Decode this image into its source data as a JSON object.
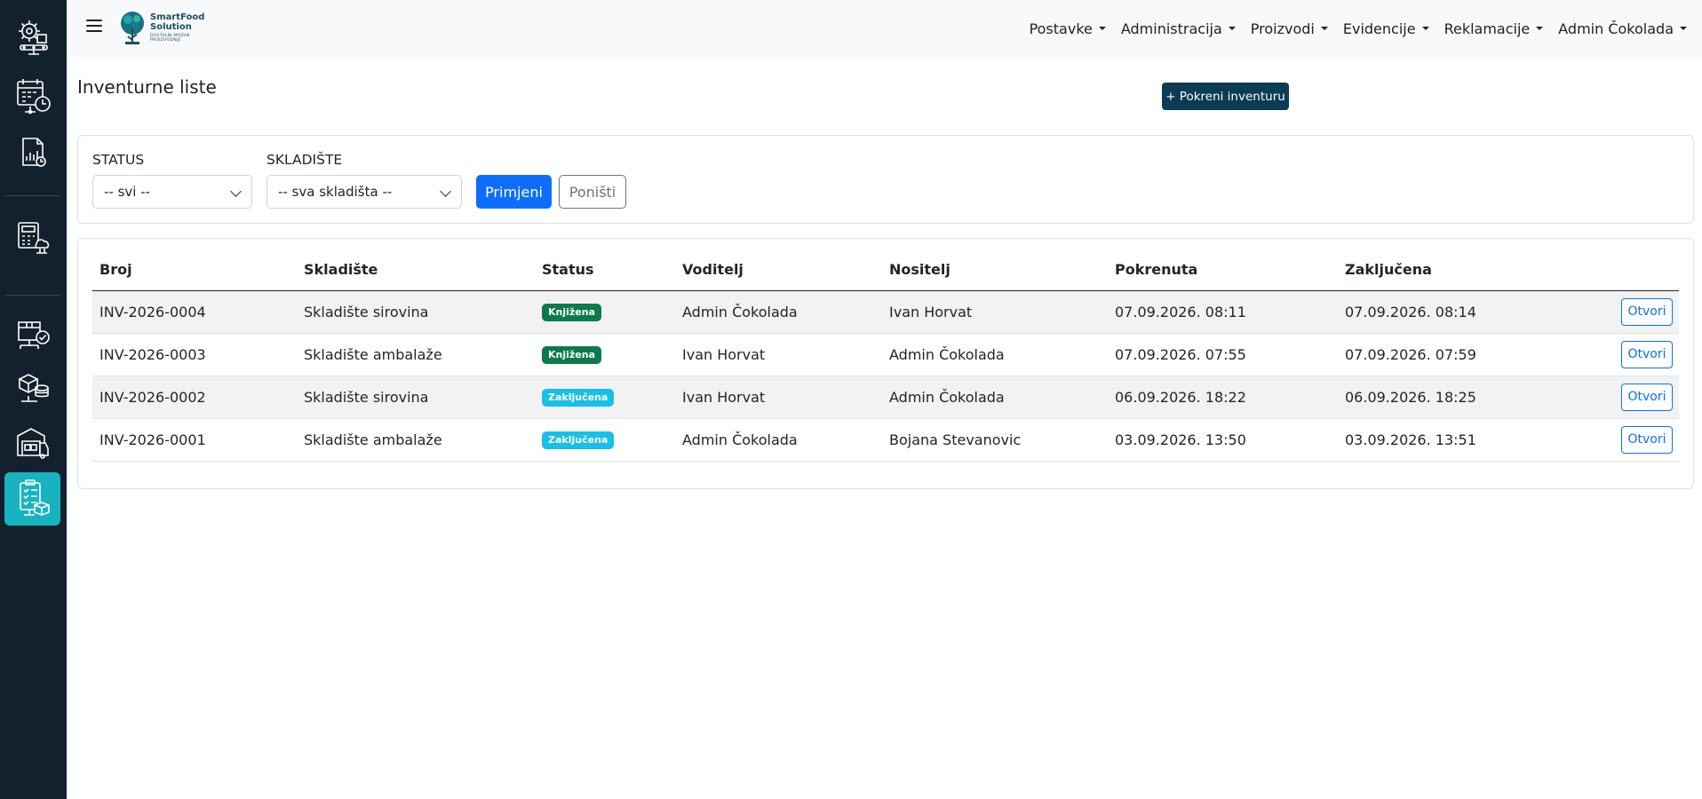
{
  "app": {
    "logo_line1": "SmartFood",
    "logo_line2": "Solution",
    "logo_tagline1": "DIGITALNI MOZAK",
    "logo_tagline2": "PROIZVODNJE"
  },
  "colors": {
    "sidebar": "#13202d",
    "active": "#18b3c1",
    "primary": "#0d6efd",
    "start_button": "#0c3b54",
    "badge_booked": "#0d7a4d",
    "badge_closed": "#17c0e8"
  },
  "sidebar": {
    "items": [
      {
        "icon": "gear-conveyor-icon",
        "active": false
      },
      {
        "icon": "calendar-clock-icon",
        "active": false
      },
      {
        "icon": "document-chart-icon",
        "active": false
      },
      {
        "icon": "calculator-cloud-icon",
        "active": false
      },
      {
        "icon": "box-check-icon",
        "active": false
      },
      {
        "icon": "boxes-stack-icon",
        "active": false
      },
      {
        "icon": "warehouse-forklift-icon",
        "active": false
      },
      {
        "icon": "clipboard-checklist-icon",
        "active": true
      }
    ]
  },
  "nav": {
    "items": [
      {
        "label": "Postavke"
      },
      {
        "label": "Administracija"
      },
      {
        "label": "Proizvodi"
      },
      {
        "label": "Evidencije"
      },
      {
        "label": "Reklamacije"
      },
      {
        "label": "Admin Čokolada"
      }
    ]
  },
  "page": {
    "title": "Inventurne liste",
    "start_button": "+ Pokreni inventuru"
  },
  "filters": {
    "status_label": "STATUS",
    "status_value": "-- svi --",
    "warehouse_label": "SKLADIŠTE",
    "warehouse_value": "-- sva skladišta --",
    "apply": "Primjeni",
    "reset": "Poništi"
  },
  "table": {
    "headers": [
      "Broj",
      "Skladište",
      "Status",
      "Voditelj",
      "Nositelj",
      "Pokrenuta",
      "Zaključena"
    ],
    "open_label": "Otvori",
    "rows": [
      {
        "num": "INV-2026-0004",
        "warehouse": "Skladište sirovina",
        "status": "Knjižena",
        "status_type": "booked",
        "lead": "Admin Čokolada",
        "holder": "Ivan Horvat",
        "started": "07.09.2026. 08:11",
        "closed": "07.09.2026. 08:14"
      },
      {
        "num": "INV-2026-0003",
        "warehouse": "Skladište ambalaže",
        "status": "Knjižena",
        "status_type": "booked",
        "lead": "Ivan Horvat",
        "holder": "Admin Čokolada",
        "started": "07.09.2026. 07:55",
        "closed": "07.09.2026. 07:59"
      },
      {
        "num": "INV-2026-0002",
        "warehouse": "Skladište sirovina",
        "status": "Zaključena",
        "status_type": "closed",
        "lead": "Ivan Horvat",
        "holder": "Admin Čokolada",
        "started": "06.09.2026. 18:22",
        "closed": "06.09.2026. 18:25"
      },
      {
        "num": "INV-2026-0001",
        "warehouse": "Skladište ambalaže",
        "status": "Zaključena",
        "status_type": "closed",
        "lead": "Admin Čokolada",
        "holder": "Bojana Stevanovic",
        "started": "03.09.2026. 13:50",
        "closed": "03.09.2026. 13:51"
      }
    ]
  }
}
